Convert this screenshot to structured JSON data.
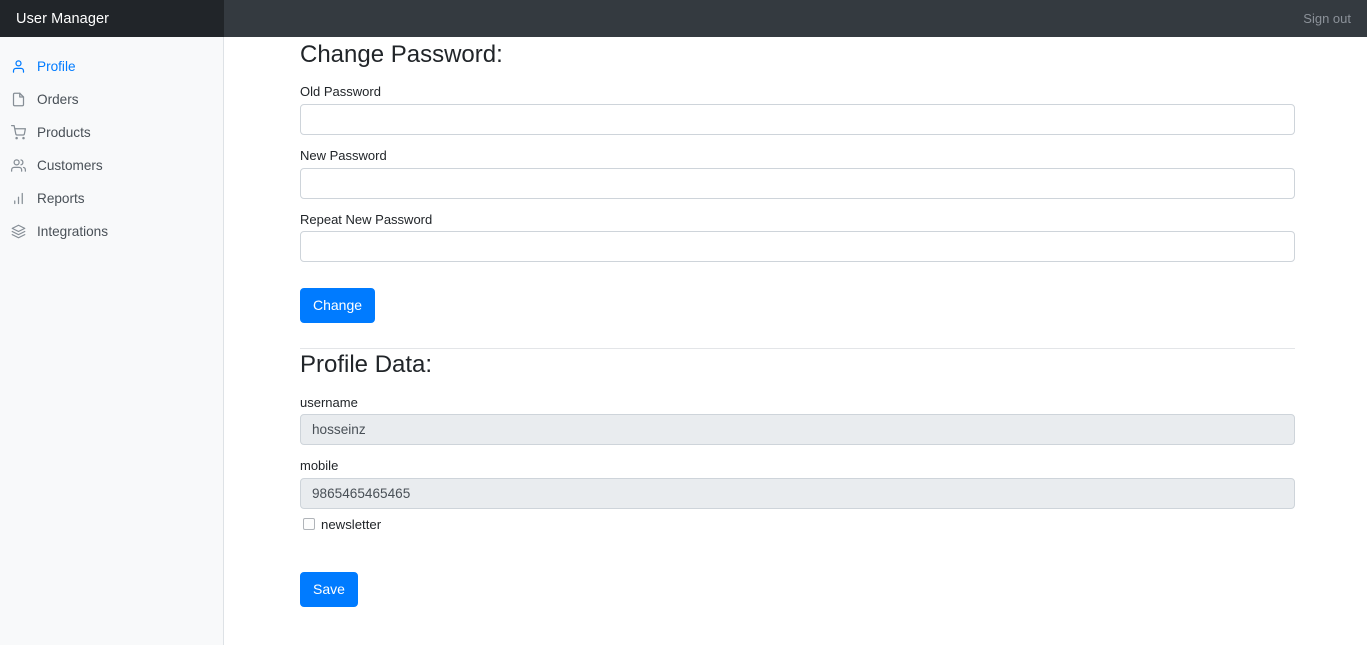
{
  "navbar": {
    "brand": "User Manager",
    "signout_label": "Sign out"
  },
  "sidebar": {
    "items": [
      {
        "label": "Profile",
        "icon": "user-icon",
        "active": true
      },
      {
        "label": "Orders",
        "icon": "file-icon",
        "active": false
      },
      {
        "label": "Products",
        "icon": "cart-icon",
        "active": false
      },
      {
        "label": "Customers",
        "icon": "users-icon",
        "active": false
      },
      {
        "label": "Reports",
        "icon": "bar-chart-icon",
        "active": false
      },
      {
        "label": "Integrations",
        "icon": "layers-icon",
        "active": false
      }
    ]
  },
  "change_password": {
    "heading": "Change Password:",
    "old_password_label": "Old Password",
    "old_password_value": "",
    "new_password_label": "New Password",
    "new_password_value": "",
    "repeat_password_label": "Repeat New Password",
    "repeat_password_value": "",
    "submit_label": "Change"
  },
  "profile_data": {
    "heading": "Profile Data:",
    "username_label": "username",
    "username_value": "hosseinz",
    "mobile_label": "mobile",
    "mobile_value": "9865465465465",
    "newsletter_label": "newsletter",
    "newsletter_checked": false,
    "submit_label": "Save"
  },
  "colors": {
    "navbar_bg": "#343a40",
    "brand_bg": "#212529",
    "sidebar_bg": "#f8f9fa",
    "accent": "#007bff",
    "readonly_bg": "#e9ecef",
    "border": "#ced4da"
  }
}
